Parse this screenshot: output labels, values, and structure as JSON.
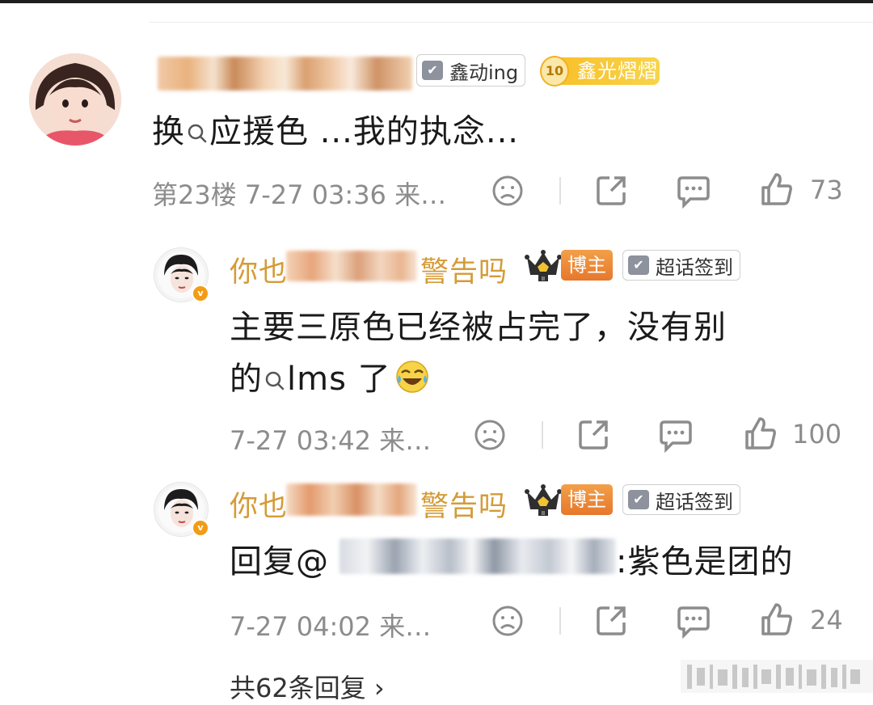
{
  "comment": {
    "badge": "鑫动ing",
    "fan_level": "10",
    "fan_badge": "鑫光熠熠",
    "content_pre": "换",
    "content_post": "应援色 ...我的执念...",
    "floor": "第23楼 7-27 03:36 来…",
    "likes": "73"
  },
  "replies": [
    {
      "name_left": "你也",
      "name_right": "警告吗",
      "role": "博主",
      "tag": "超话签到",
      "line1": "主要三原色已经被占完了，没有别",
      "line2_pre": "的",
      "line2_post": "lms 了",
      "time": "7-27 03:42 来…",
      "likes": "100"
    },
    {
      "name_left": "你也",
      "name_right": "警告吗",
      "role": "博主",
      "tag": "超话签到",
      "reply_prefix": "回复@",
      "reply_suffix": ":紫色是团的",
      "time": "7-27 04:02 来…",
      "likes": "24"
    }
  ],
  "more_replies": "共62条回复 ›",
  "colors": {
    "username": "#d49b37",
    "meta": "#8c8c8c",
    "bozhu": "#e6772b",
    "fan": "#f7c93a"
  }
}
